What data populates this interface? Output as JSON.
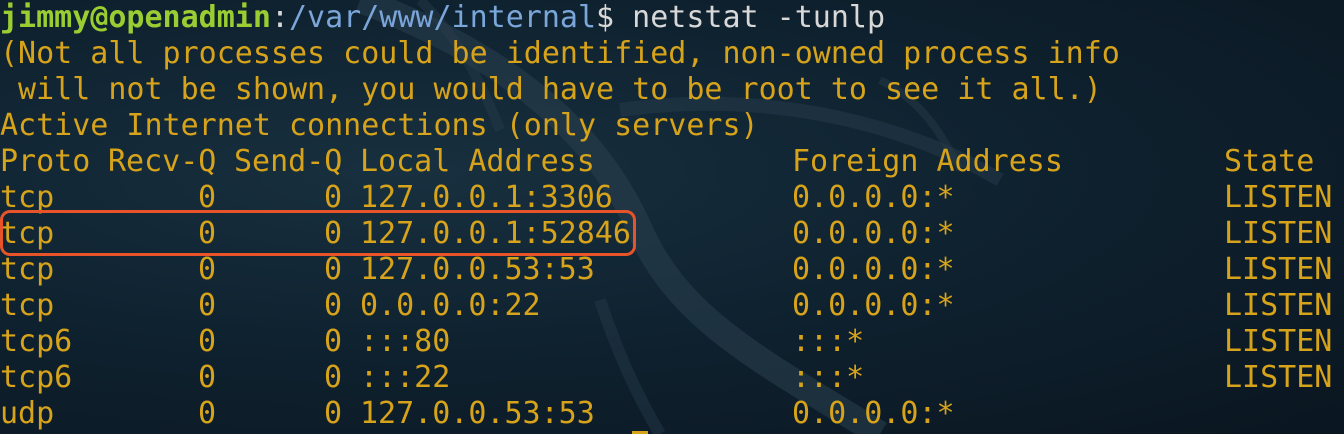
{
  "prompt": {
    "user_host": "jimmy@openadmin",
    "separator": ":",
    "path": "/var/www/internal",
    "symbol": "$",
    "command": " netstat -tunlp"
  },
  "messages": [
    "(Not all processes could be identified, non-owned process info",
    " will not be shown, you would have to be root to see it all.)",
    "Active Internet connections (only servers)"
  ],
  "table": {
    "headers": {
      "proto": "Proto",
      "recvq": "Recv-Q",
      "sendq": "Send-Q",
      "local": "Local Address",
      "foreign": "Foreign Address",
      "state": "State"
    },
    "rows": [
      {
        "proto": "tcp",
        "recvq": "0",
        "sendq": "0",
        "local": "127.0.0.1:3306",
        "foreign": "0.0.0.0:*",
        "state": "LISTEN"
      },
      {
        "proto": "tcp",
        "recvq": "0",
        "sendq": "0",
        "local": "127.0.0.1:52846",
        "foreign": "0.0.0.0:*",
        "state": "LISTEN"
      },
      {
        "proto": "tcp",
        "recvq": "0",
        "sendq": "0",
        "local": "127.0.0.53:53",
        "foreign": "0.0.0.0:*",
        "state": "LISTEN"
      },
      {
        "proto": "tcp",
        "recvq": "0",
        "sendq": "0",
        "local": "0.0.0.0:22",
        "foreign": "0.0.0.0:*",
        "state": "LISTEN"
      },
      {
        "proto": "tcp6",
        "recvq": "0",
        "sendq": "0",
        "local": ":::80",
        "foreign": ":::*",
        "state": "LISTEN"
      },
      {
        "proto": "tcp6",
        "recvq": "0",
        "sendq": "0",
        "local": ":::22",
        "foreign": ":::*",
        "state": "LISTEN"
      },
      {
        "proto": "udp",
        "recvq": "0",
        "sendq": "0",
        "local": "127.0.0.53:53",
        "foreign": "0.0.0.0:*",
        "state": ""
      }
    ]
  },
  "highlighted_row_index": 1,
  "colors": {
    "background": "#0f2230",
    "output_text": "#d6a31a",
    "user_host": "#9acd32",
    "path": "#7aa6da",
    "command": "#d8d8d8",
    "highlight_border": "#e8542a"
  }
}
